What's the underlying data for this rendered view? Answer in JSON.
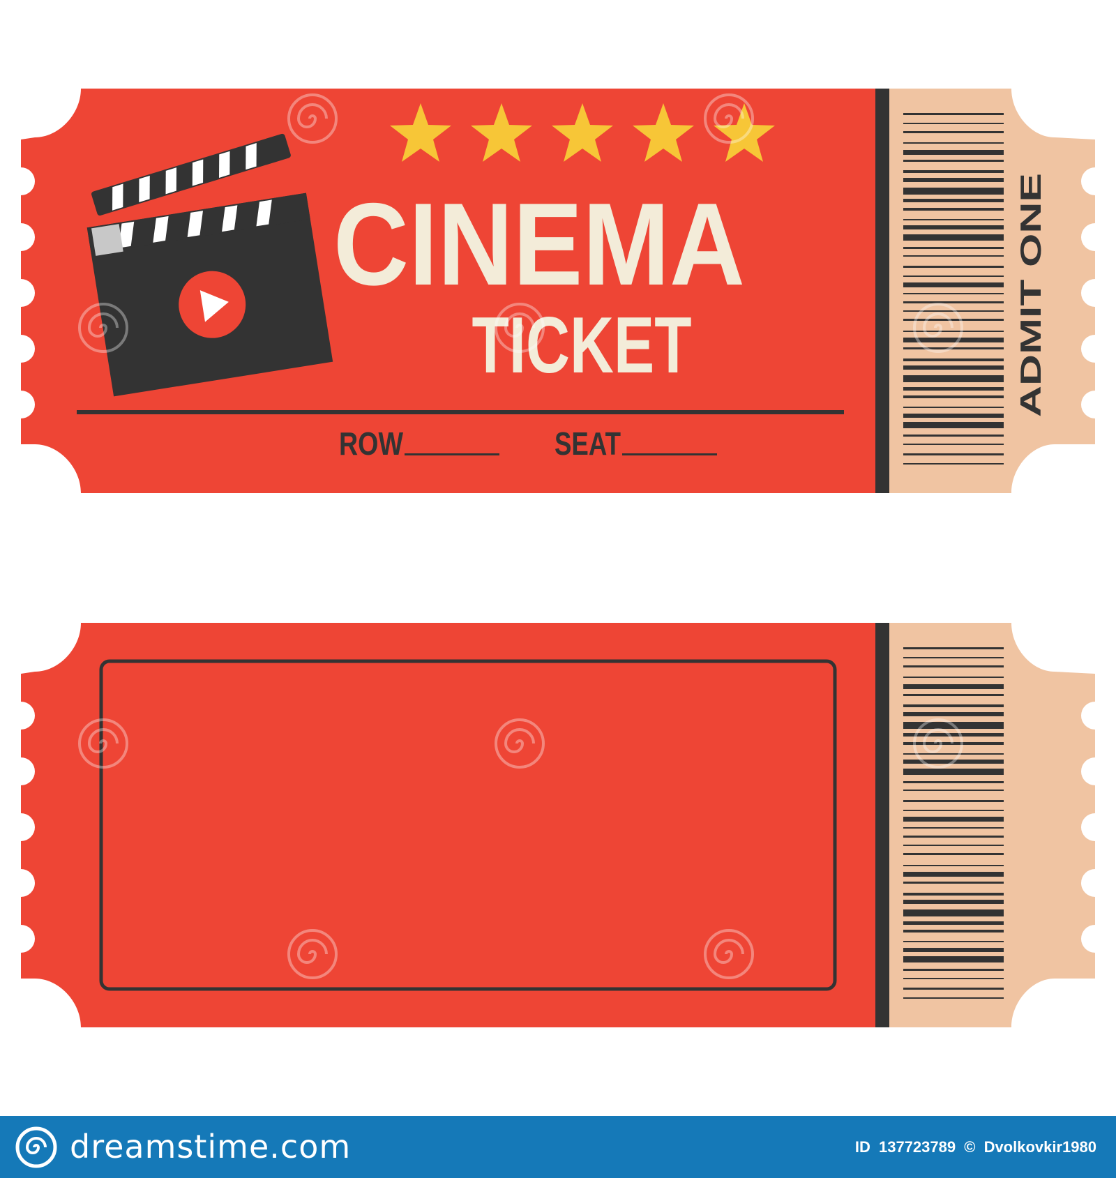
{
  "ticket_top": {
    "title": "CINEMA",
    "subtitle": "TICKET",
    "row_label": "ROW",
    "seat_label": "SEAT",
    "admit_label": "ADMIT ONE",
    "rating_stars": 5
  },
  "ticket_bottom": {
    "blank_field": ""
  },
  "watermark": {
    "text": "dreamstime"
  },
  "footer": {
    "brand": "dreamstime.com",
    "id_label": "ID",
    "id_value": "137723789",
    "copyright_symbol": "©",
    "author": "Dvolkovkir1980"
  },
  "colors": {
    "ticket_red": "#ee4535",
    "stub_beige": "#f0c4a2",
    "dark": "#333333",
    "cream": "#f3ecd9",
    "star": "#f7c637",
    "footer_blue": "#1579b8"
  },
  "icons": [
    "clapperboard-icon",
    "play-icon",
    "star-icon",
    "barcode-icon",
    "spiral-logo-icon"
  ]
}
